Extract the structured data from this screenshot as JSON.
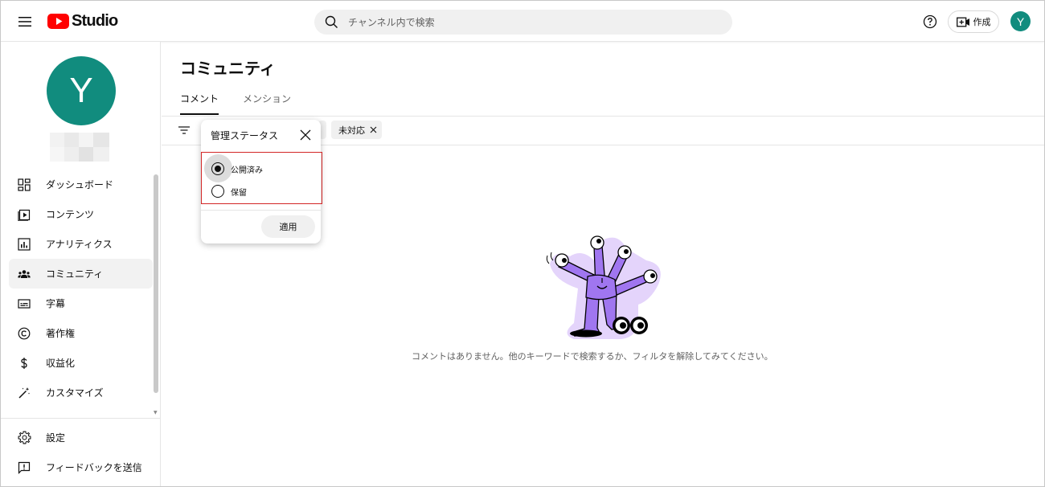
{
  "header": {
    "logo_text": "Studio",
    "search_placeholder": "チャンネル内で検索",
    "create_label": "作成",
    "avatar_letter": "Y"
  },
  "sidebar": {
    "avatar_letter": "Y",
    "items": [
      {
        "label": "ダッシュボード",
        "icon": "dashboard-icon"
      },
      {
        "label": "コンテンツ",
        "icon": "content-icon"
      },
      {
        "label": "アナリティクス",
        "icon": "analytics-icon"
      },
      {
        "label": "コミュニティ",
        "icon": "community-icon",
        "active": true
      },
      {
        "label": "字幕",
        "icon": "subtitles-icon"
      },
      {
        "label": "著作権",
        "icon": "copyright-icon"
      },
      {
        "label": "収益化",
        "icon": "monetization-icon"
      },
      {
        "label": "カスタマイズ",
        "icon": "customize-icon"
      }
    ],
    "bottom_items": [
      {
        "label": "設定",
        "icon": "settings-icon"
      },
      {
        "label": "フィードバックを送信",
        "icon": "feedback-icon"
      }
    ]
  },
  "main": {
    "title": "コミュニティ",
    "tabs": [
      {
        "label": "コメント",
        "active": true
      },
      {
        "label": "メンション",
        "active": false
      }
    ],
    "chips": [
      {
        "label": "未対応"
      }
    ],
    "empty_message": "コメントはありません。他のキーワードで検索するか、フィルタを解除してみてください。"
  },
  "popup": {
    "title": "管理ステータス",
    "options": [
      {
        "label": "公開済み",
        "checked": true
      },
      {
        "label": "保留",
        "checked": false
      }
    ],
    "apply_label": "適用"
  },
  "colors": {
    "avatar": "#118c7e",
    "brand_red": "#ff0000",
    "highlight_border": "#d32626",
    "illustration_purple": "#a076f0"
  }
}
